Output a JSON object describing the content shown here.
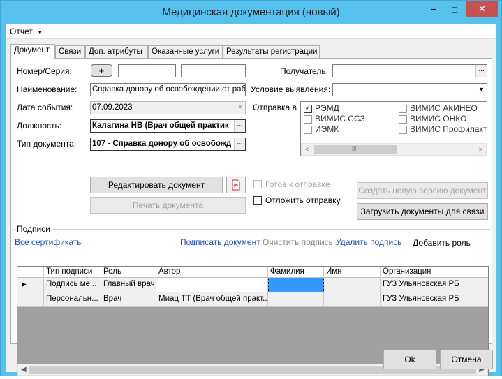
{
  "window": {
    "title": "Медицинская документация (новый)",
    "minimize": "−",
    "maximize": "□",
    "close": "✕"
  },
  "menu": {
    "report": "Отчет"
  },
  "tabs": [
    "Документ",
    "Связи",
    "Доп. атрибуты",
    "Оказанные услуги",
    "Результаты регистрации"
  ],
  "form": {
    "number_label": "Номер/Серия:",
    "number_button": "+",
    "name_label": "Наименование:",
    "name_value": "Справка донору об освобождении от работ",
    "date_label": "Дата события:",
    "date_value": "07.09.2023",
    "position_label": "Должность:",
    "position_value": "Калагина НВ (Врач общей практик",
    "doctype_label": "Тип документа:",
    "doctype_value": "107 - Справка донору об освобожд",
    "ellipsis": "...",
    "recipient_label": "Получатель:",
    "condition_label": "Условие выявления:",
    "send_to_label": "Отправка в"
  },
  "send_targets": [
    {
      "label": "РЭМД",
      "checked": true
    },
    {
      "label": "ВИМИС АКИНЕО",
      "checked": false
    },
    {
      "label": "ВИМИС ССЗ",
      "checked": false
    },
    {
      "label": "ВИМИС ОНКО",
      "checked": false
    },
    {
      "label": "ИЭМК",
      "checked": false
    },
    {
      "label": "ВИМИС Профилактика",
      "checked": false
    }
  ],
  "buttons": {
    "edit_document": "Редактировать документ",
    "print_document": "Печать документа",
    "create_new_version": "Создать новую версию документ",
    "load_documents": "Загрузить документы для связи",
    "ok": "Ok",
    "cancel": "Отмена"
  },
  "checks": {
    "ready_to_send": "Готов к отправке",
    "postpone_send": "Отложить отправку"
  },
  "signatures": {
    "group_label": "Подписи",
    "all_certificates": "Все сертификаты",
    "sign_document": "Подписать документ",
    "clear_signature": "Очистить подпись",
    "delete_signature": "Удалить подпись",
    "add_role": "Добавить роль",
    "columns": [
      "Тип подписи",
      "Роль",
      "Автор",
      "Фамилия",
      "Имя",
      "Организация"
    ],
    "rows": [
      [
        "Подпись ме...",
        "Главный врач",
        "",
        "",
        "",
        "ГУЗ Ульяновская РБ"
      ],
      [
        "Персональн...",
        "Врач",
        "Миац ТТ (Врач общей практ...",
        "",
        "",
        "ГУЗ Ульяновская РБ"
      ]
    ]
  },
  "colors": {
    "title_bar": "#56c1ec",
    "selection": "#3399ff",
    "link": "#1a4dc2",
    "close_button": "#c75050"
  }
}
